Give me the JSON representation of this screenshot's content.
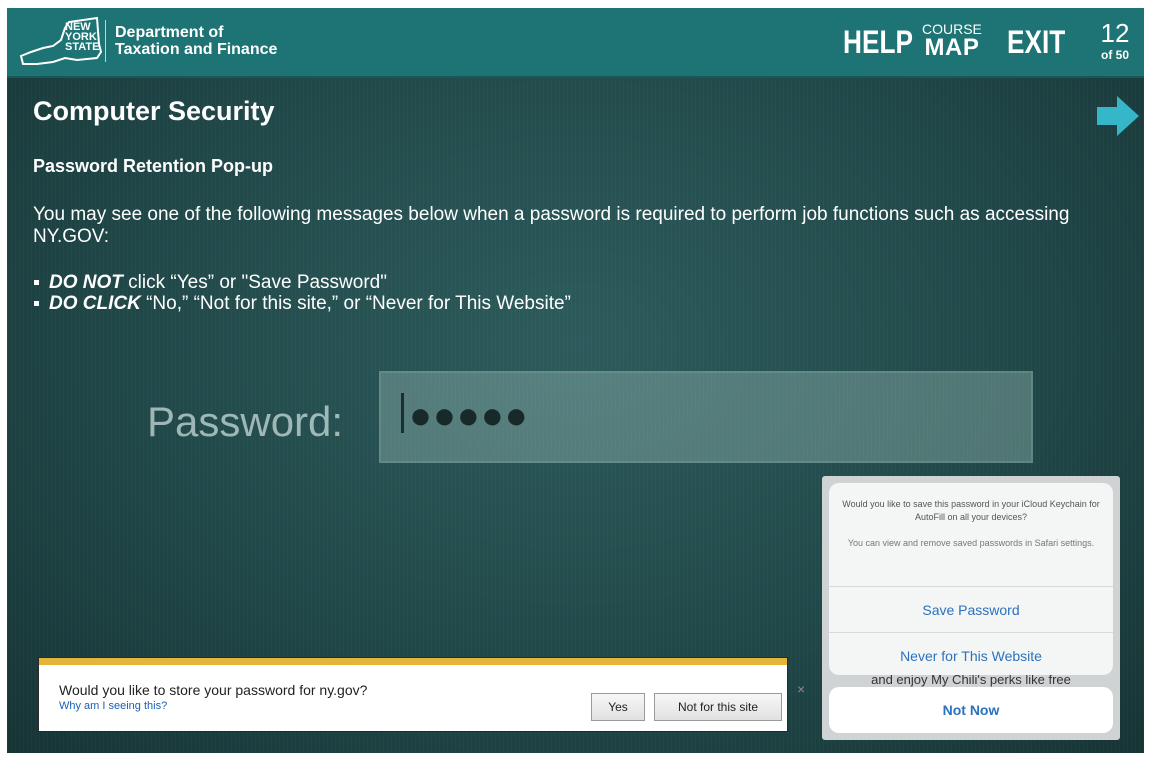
{
  "header": {
    "logo_lines": [
      "NEW",
      "YORK",
      "STATE"
    ],
    "dept_line1": "Department of",
    "dept_line2": "Taxation and Finance",
    "help_label": "HELP",
    "course_label": "COURSE",
    "map_label": "MAP",
    "exit_label": "EXIT",
    "page_current": "12",
    "page_total": "of 50"
  },
  "content": {
    "title": "Computer Security",
    "subtitle": "Password Retention Pop-up",
    "intro": "You may see one of the following messages below when a password is required to perform job functions such as accessing NY.GOV:",
    "bullets": [
      {
        "emphasis": "DO NOT",
        "text": " click “Yes” or \"Save Password\""
      },
      {
        "emphasis": "DO CLICK",
        "text": " “No,” “Not for this site,” or “Never for This Website”"
      }
    ]
  },
  "password_illustration": {
    "label": "Password:",
    "masked_value": "●●●●●"
  },
  "ie_prompt": {
    "question": "Would you like to store your password for ny.gov?",
    "why_link": "Why am I seeing this?",
    "yes_label": "Yes",
    "not_label": "Not for this site",
    "close_glyph": "×",
    "accent_color": "#e5b43a"
  },
  "ios_prompt": {
    "question": "Would you like to save this password in your iCloud Keychain for AutoFill on all your devices?",
    "note": "You can view and remove saved passwords in Safari settings.",
    "save_label": "Save Password",
    "never_label": "Never for This Website",
    "behind_text": "and enjoy My Chili's perks like free",
    "not_now_label": "Not Now",
    "accent_color": "#2b72bd"
  },
  "icons": {
    "next": "arrow-right-icon",
    "logo": "ny-state-outline-logo"
  }
}
